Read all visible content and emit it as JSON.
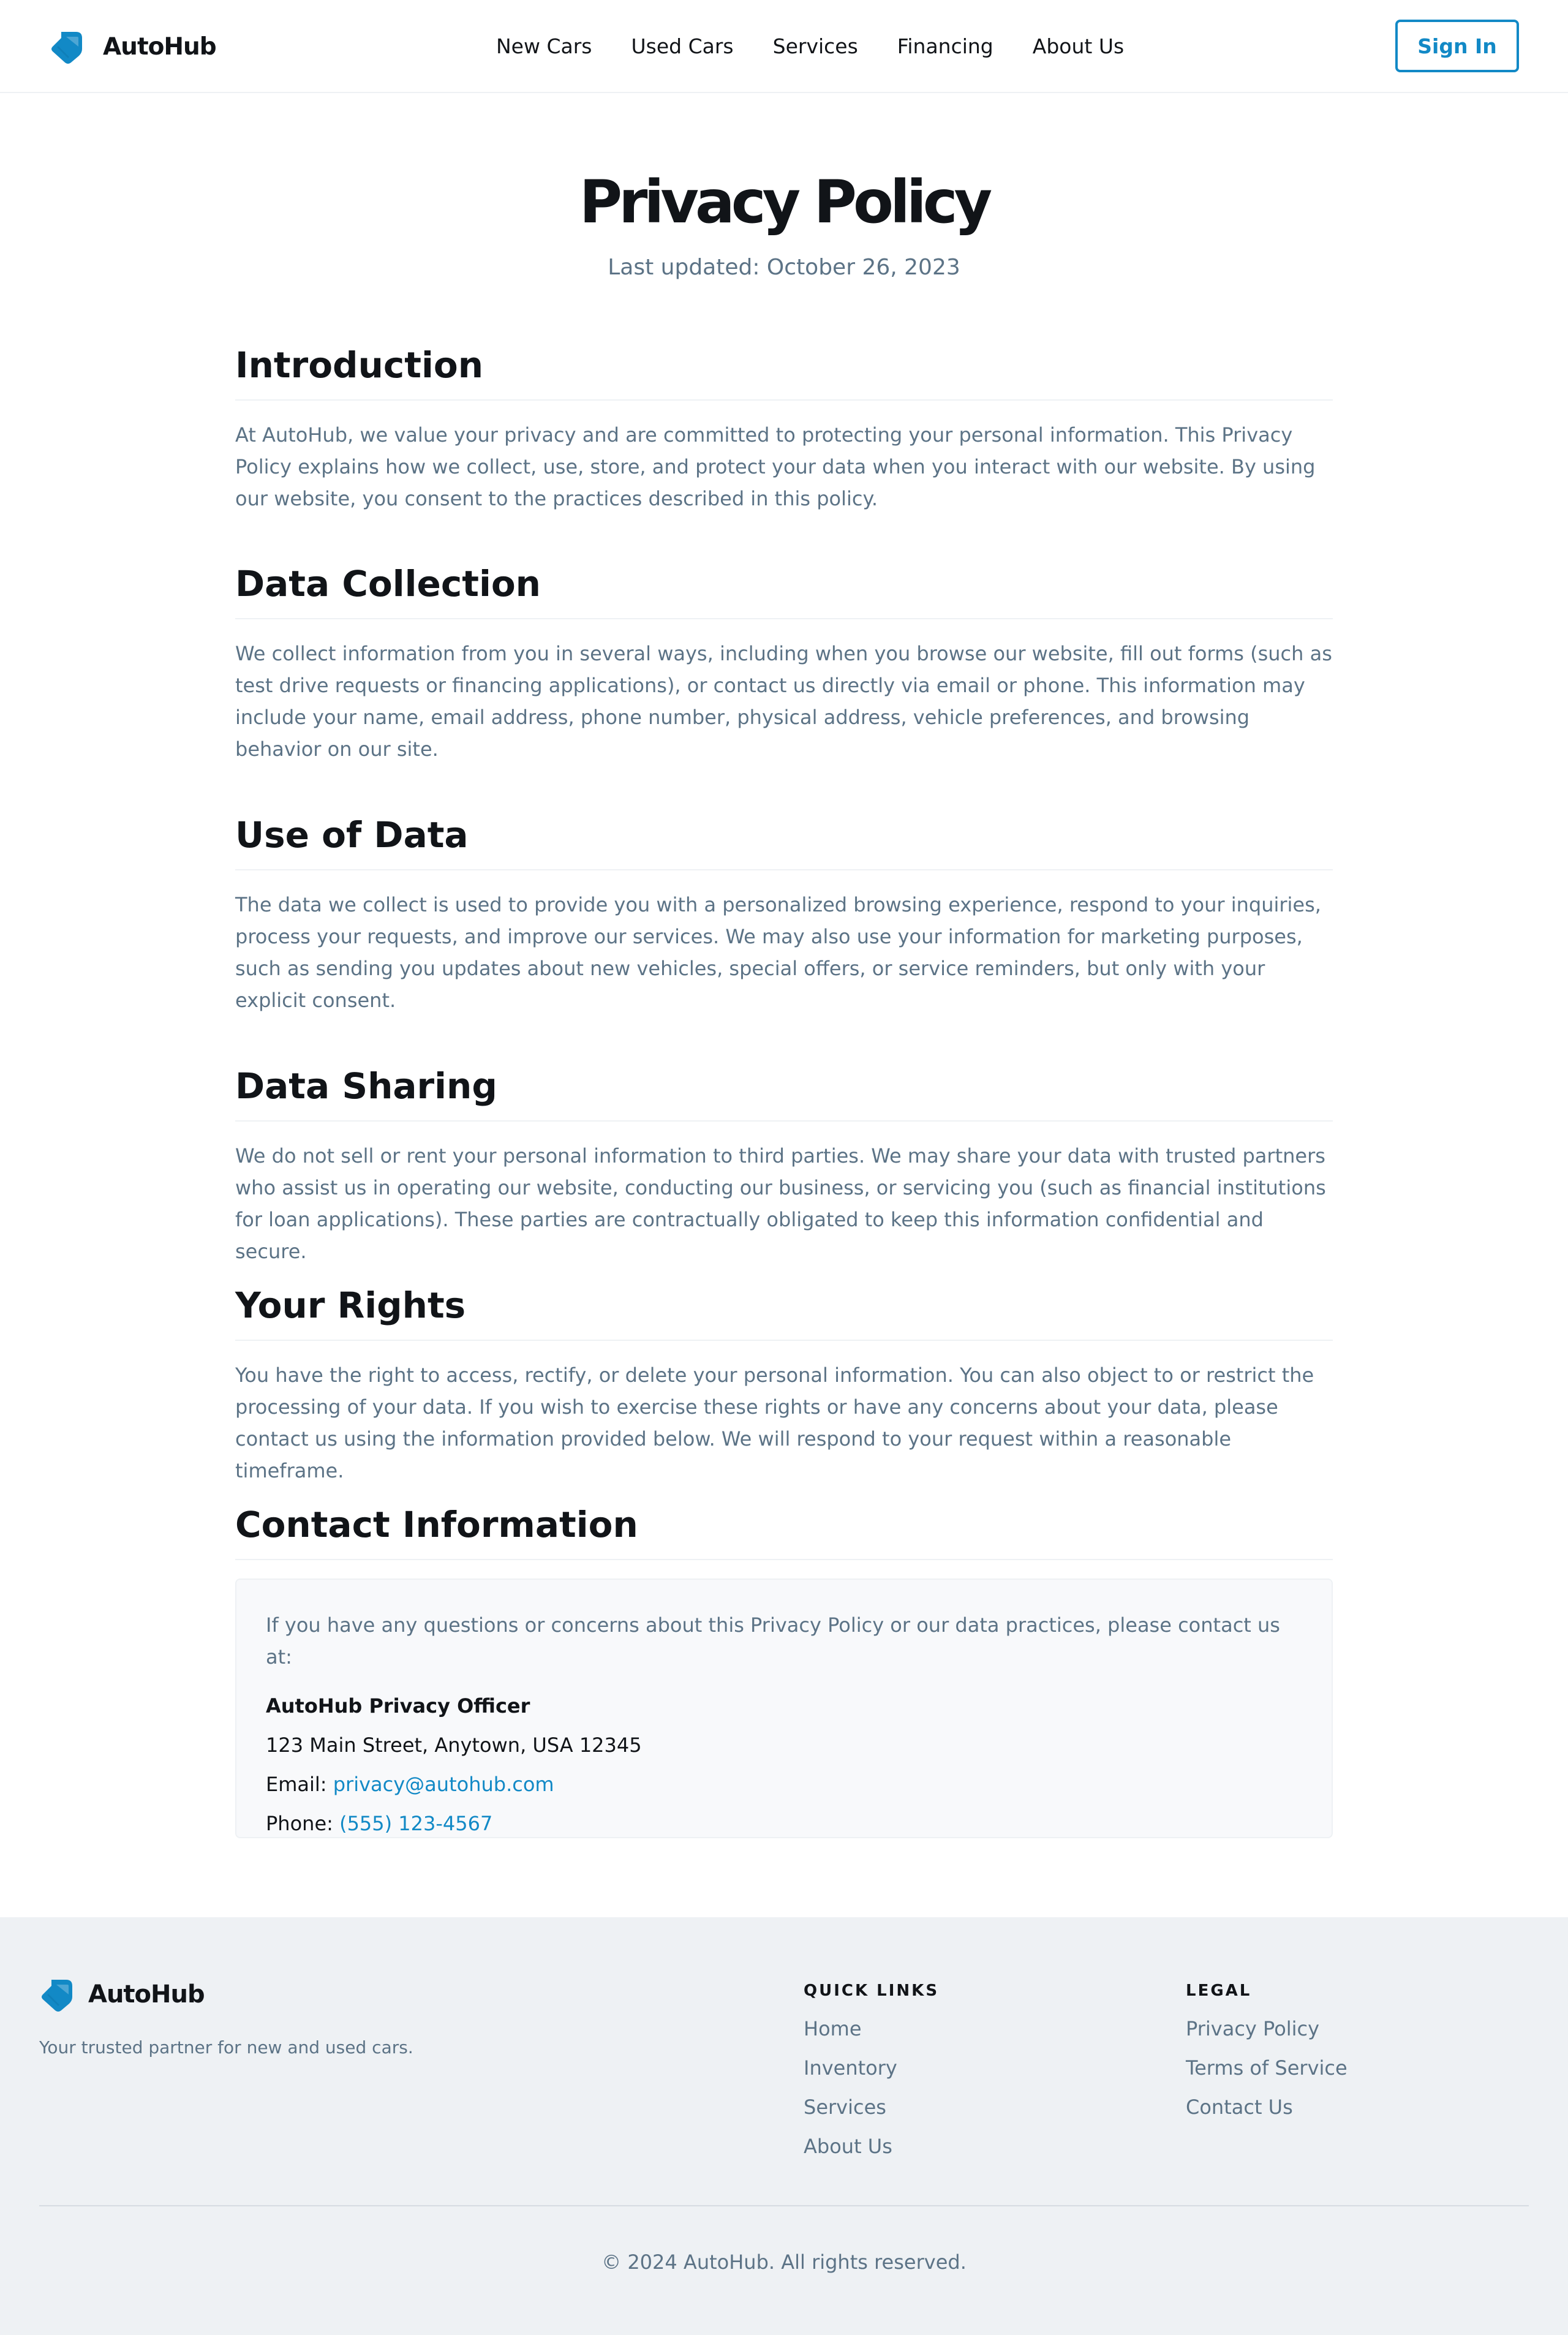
{
  "header": {
    "brand": "AutoHub",
    "nav": [
      "New Cars",
      "Used Cars",
      "Services",
      "Financing",
      "About Us"
    ],
    "sign_in": "Sign In"
  },
  "page": {
    "title": "Privacy Policy",
    "updated": "Last updated: October 26, 2023"
  },
  "sections": [
    {
      "heading": "Introduction",
      "body": "At AutoHub, we value your privacy and are committed to protecting your personal information. This Privacy Policy explains how we collect, use, store, and protect your data when you interact with our website. By using our website, you consent to the practices described in this policy."
    },
    {
      "heading": "Data Collection",
      "body": "We collect information from you in several ways, including when you browse our website, fill out forms (such as test drive requests or financing applications), or contact us directly via email or phone. This information may include your name, email address, phone number, physical address, vehicle preferences, and browsing behavior on our site."
    },
    {
      "heading": "Use of Data",
      "body": "The data we collect is used to provide you with a personalized browsing experience, respond to your inquiries, process your requests, and improve our services. We may also use your information for marketing purposes, such as sending you updates about new vehicles, special offers, or service reminders, but only with your explicit consent."
    },
    {
      "heading": "Data Sharing",
      "body": "We do not sell or rent your personal information to third parties. We may share your data with trusted partners who assist us in operating our website, conducting our business, or servicing you (such as financial institutions for loan applications). These parties are contractually obligated to keep this information confidential and secure."
    },
    {
      "heading": "Your Rights",
      "body": "You have the right to access, rectify, or delete your personal information. You can also object to or restrict the processing of your data. If you wish to exercise these rights or have any concerns about your data, please contact us using the information provided below. We will respond to your request within a reasonable timeframe."
    }
  ],
  "contact": {
    "heading": "Contact Information",
    "intro": "If you have any questions or concerns about this Privacy Policy or our data practices, please contact us at:",
    "org": "AutoHub Privacy Officer",
    "address": "123 Main Street, Anytown, USA 12345",
    "email_label": "Email:",
    "email": "privacy@autohub.com",
    "phone_label": "Phone:",
    "phone": "(555) 123-4567"
  },
  "footer": {
    "brand": "AutoHub",
    "tagline": "Your trusted partner for new and used cars.",
    "quick_links": {
      "title": "QUICK LINKS",
      "items": [
        "Home",
        "Inventory",
        "Services",
        "About Us"
      ]
    },
    "legal": {
      "title": "LEGAL",
      "items": [
        "Privacy Policy",
        "Terms of Service",
        "Contact Us"
      ]
    },
    "copyright": "© 2024 AutoHub. All rights reserved."
  },
  "colors": {
    "accent": "#1289c6",
    "text": "#111418",
    "muted": "#5c7386",
    "footer_bg": "#eef1f4"
  },
  "icons": {
    "brand": "tag-logo-icon"
  }
}
